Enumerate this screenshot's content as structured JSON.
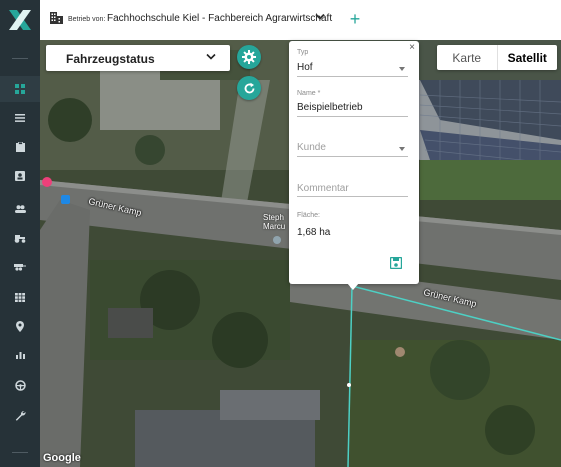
{
  "app": {
    "logo_name": "X"
  },
  "sidebar": {
    "items": [
      {
        "icon": "dashboard-icon",
        "active": true
      },
      {
        "icon": "list-icon"
      },
      {
        "icon": "clipboard-icon"
      },
      {
        "icon": "contact-card-icon"
      },
      {
        "icon": "users-icon"
      },
      {
        "icon": "tractor-icon"
      },
      {
        "icon": "trailer-icon"
      },
      {
        "icon": "grid-icon"
      },
      {
        "icon": "map-pin-icon"
      },
      {
        "icon": "bar-chart-icon"
      },
      {
        "icon": "steering-wheel-icon"
      },
      {
        "icon": "wrench-icon"
      }
    ]
  },
  "header": {
    "betrieb_label": "Betrieb von:",
    "betrieb_name": "Fachhochschule Kiel - Fachbereich Agrarwirtschaft",
    "add_label": "+"
  },
  "map": {
    "status_select": "Fahrzeugstatus",
    "maptype": {
      "map_label": "Karte",
      "satellite_label": "Satellit",
      "selected": "Satellit"
    },
    "road_labels": [
      "Grüner Kamp",
      "Grüner Kamp"
    ],
    "poi_label_line1": "Steph",
    "poi_label_line2": "Marcu",
    "attribution": "Google"
  },
  "popup": {
    "close": "×",
    "typ_label": "Typ",
    "typ_value": "Hof",
    "name_label": "Name *",
    "name_value": "Beispielbetrieb",
    "kunde_placeholder": "Kunde",
    "kommentar_placeholder": "Kommentar",
    "flaeche_label": "Fläche:",
    "flaeche_value": "1,68 ha"
  },
  "colors": {
    "accent": "#26a69a",
    "sidebar": "#263238"
  }
}
